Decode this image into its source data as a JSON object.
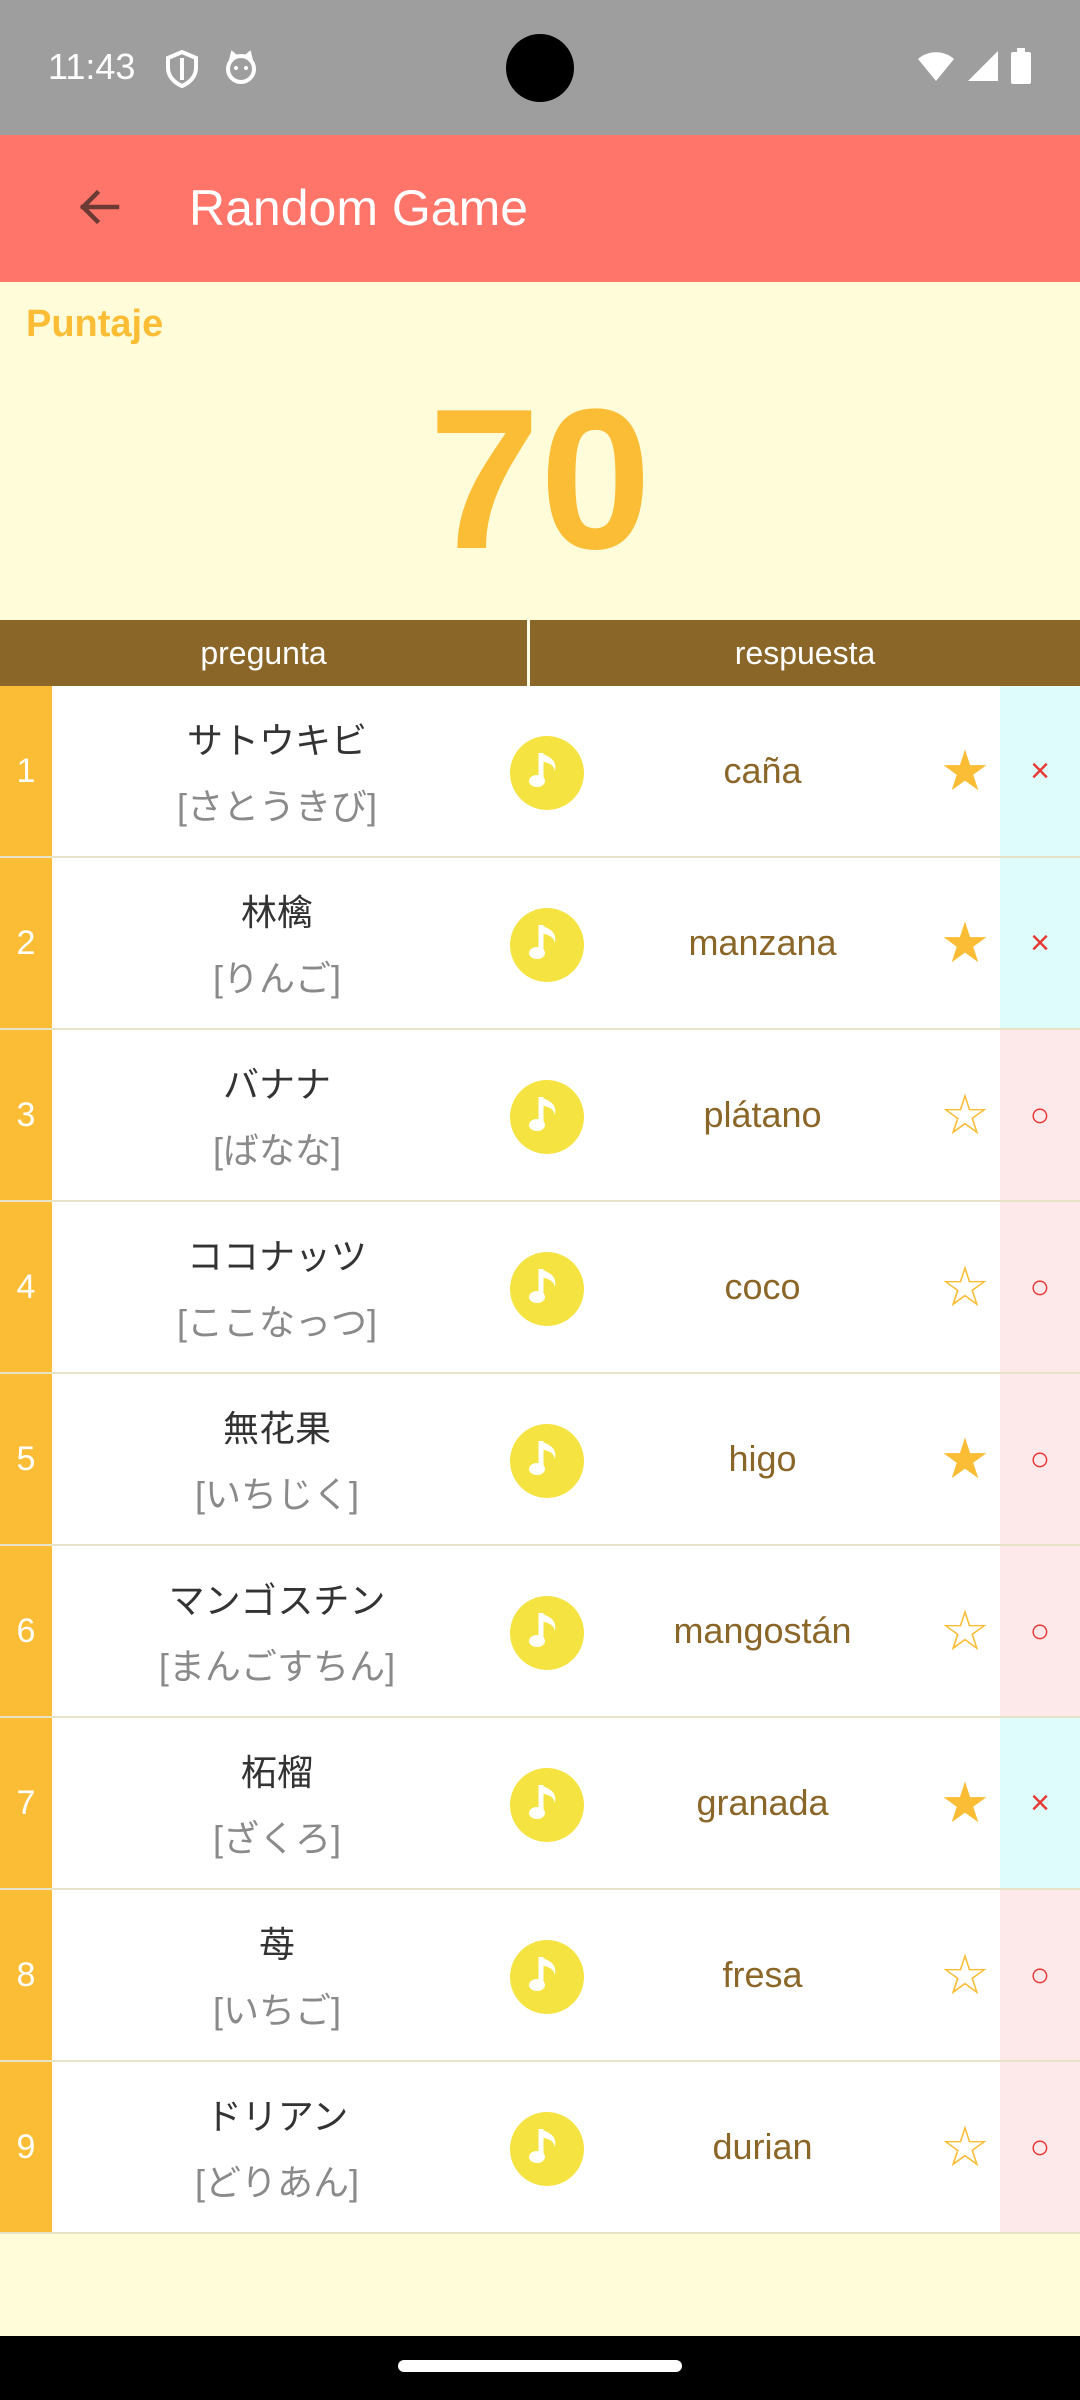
{
  "status_bar": {
    "time": "11:43"
  },
  "app_bar": {
    "title": "Random Game"
  },
  "score": {
    "label": "Puntaje",
    "value": "70"
  },
  "table": {
    "headers": {
      "question": "pregunta",
      "answer": "respuesta"
    },
    "rows": [
      {
        "index": "1",
        "question": "サトウキビ",
        "reading": "[さとうきび]",
        "answer": "caña",
        "starred": true,
        "result": "×"
      },
      {
        "index": "2",
        "question": "林檎",
        "reading": "[りんご]",
        "answer": "manzana",
        "starred": true,
        "result": "×"
      },
      {
        "index": "3",
        "question": "バナナ",
        "reading": "[ばなな]",
        "answer": "plátano",
        "starred": false,
        "result": "○"
      },
      {
        "index": "4",
        "question": "ココナッツ",
        "reading": "[ここなっつ]",
        "answer": "coco",
        "starred": false,
        "result": "○"
      },
      {
        "index": "5",
        "question": "無花果",
        "reading": "[いちじく]",
        "answer": "higo",
        "starred": true,
        "result": "○"
      },
      {
        "index": "6",
        "question": "マンゴスチン",
        "reading": "[まんごすちん]",
        "answer": "mangostán",
        "starred": false,
        "result": "○"
      },
      {
        "index": "7",
        "question": "柘榴",
        "reading": "[ざくろ]",
        "answer": "granada",
        "starred": true,
        "result": "×"
      },
      {
        "index": "8",
        "question": "苺",
        "reading": "[いちご]",
        "answer": "fresa",
        "starred": false,
        "result": "○"
      },
      {
        "index": "9",
        "question": "ドリアン",
        "reading": "[どりあん]",
        "answer": "durian",
        "starred": false,
        "result": "○"
      }
    ]
  },
  "icons": {
    "audio": "music-note-icon",
    "star_filled": "★",
    "star_empty": "☆"
  },
  "colors": {
    "app_bar": "#ff756a",
    "accent": "#fbbd35",
    "header": "#8b6629",
    "background": "#fffdd9"
  }
}
